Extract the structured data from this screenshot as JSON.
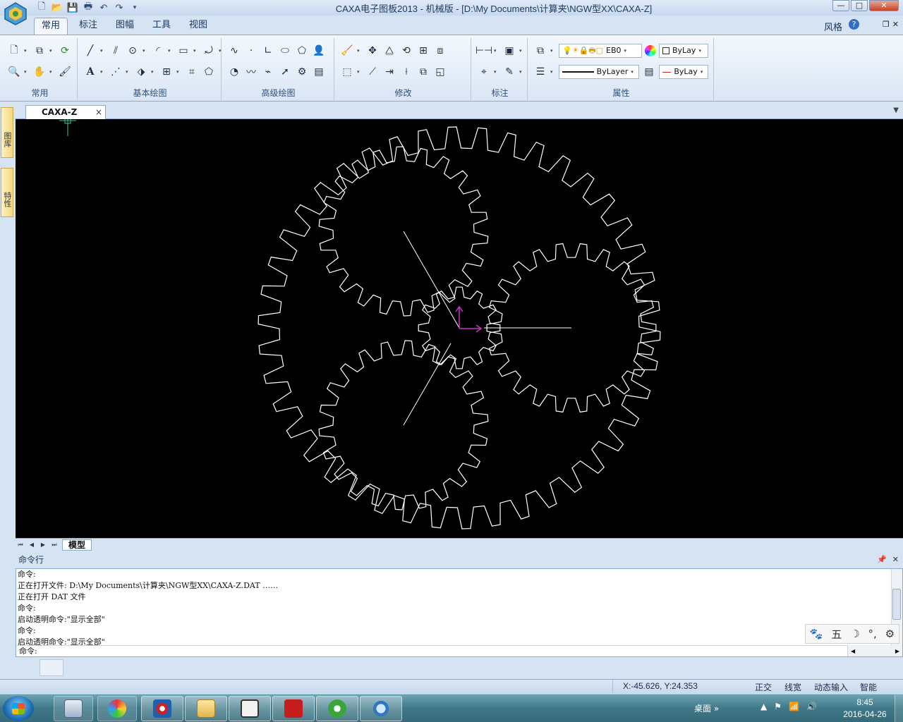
{
  "window": {
    "title": "CAXA电子图板2013 - 机械版 - [D:\\My Documents\\计算夹\\NGW型XX\\CAXA-Z]",
    "minimize": "—",
    "maximize": "□",
    "close": "✕"
  },
  "ribbon": {
    "tabs": [
      {
        "label": "常用",
        "active": true
      },
      {
        "label": "标注"
      },
      {
        "label": "图幅"
      },
      {
        "label": "工具"
      },
      {
        "label": "视图"
      }
    ],
    "style_label": "风格",
    "help": "?",
    "groups": {
      "common": "常用",
      "basic_draw": "基本绘图",
      "advanced_draw": "高级绘图",
      "modify": "修改",
      "annotate": "标注",
      "properties": "属性"
    },
    "properties": {
      "layer": "EB0",
      "color": "ByLay",
      "linetype": "ByLayer",
      "linewidth": "ByLay"
    }
  },
  "side_tabs": [
    "图库",
    "特性"
  ],
  "document_tab": {
    "label": "CAXA-Z",
    "close": "×"
  },
  "model_tab": "模型",
  "command": {
    "header": "命令行",
    "history": [
      "命令:",
      "正在打开文件: D:\\My Documents\\计算夹\\NGW型XX\\CAXA-Z.DAT ……",
      "正在打开 DAT 文件",
      "命令:",
      "启动透明命令:\"显示全部\"",
      "命令:",
      "启动透明命令:\"显示全部\""
    ],
    "prompt": "命令:"
  },
  "ime_toolbar": [
    "🐾",
    "五",
    "☽",
    "°,",
    "⚙"
  ],
  "statusbar": {
    "coords": "X:-45.626, Y:24.353",
    "ortho": "正交",
    "linewidth": "线宽",
    "dynamic_input": "动态输入",
    "smart": "智能"
  },
  "taskbar": {
    "desktop": "桌面",
    "chevron": "»",
    "time": "8:45",
    "date": "2016-04-26"
  },
  "colors": {
    "canvas_bg": "#000000",
    "gear_stroke": "#ffffff",
    "axis_marker": "#cc33cc",
    "ribbon_bg": "#e6eef9"
  }
}
